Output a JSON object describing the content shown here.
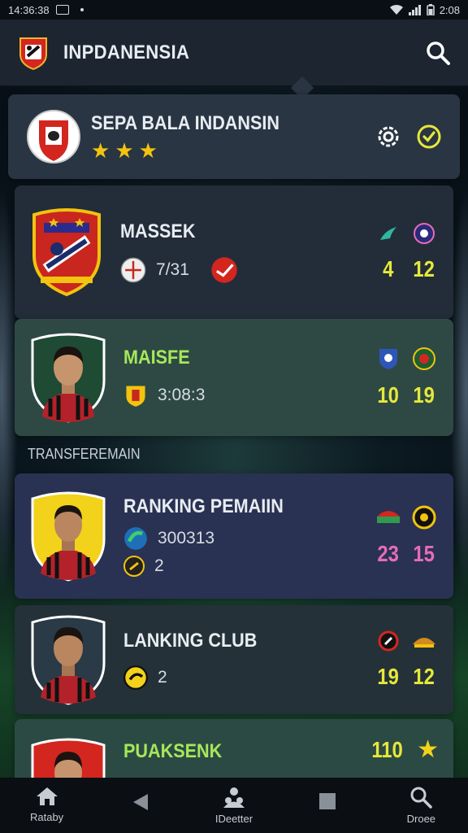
{
  "status_bar": {
    "time": "14:36:38",
    "right_time": "2:08"
  },
  "app_bar": {
    "title": "INPDANENSIA"
  },
  "league": {
    "name": "SEPA BALA INDANSIN",
    "stars": 3
  },
  "cards": [
    {
      "name": "MASSEK",
      "meta_text": "7/31",
      "stats": [
        "4",
        "12"
      ]
    },
    {
      "name": "MAISFE",
      "meta_text": "3:08:3",
      "stats": [
        "10",
        "19"
      ]
    },
    {
      "name": "RANKING PEMAIIN",
      "meta_text": "300313",
      "meta_text_2": "2",
      "stats": [
        "23",
        "15"
      ]
    },
    {
      "name": "LANKING CLUB",
      "meta_text": "2",
      "stats": [
        "19",
        "12"
      ]
    },
    {
      "name": "PUAKSENK",
      "stats": [
        "110"
      ]
    }
  ],
  "section_label": "TRANSFEREMAIN",
  "nav": [
    {
      "label": "Rataby",
      "icon": "home-icon"
    },
    {
      "label": "",
      "icon": "back-icon"
    },
    {
      "label": "IDeetter",
      "icon": "people-icon"
    },
    {
      "label": "",
      "icon": "square-icon"
    },
    {
      "label": "Droee",
      "icon": "search-icon"
    }
  ],
  "colors": {
    "accent_yellow": "#e6e83a",
    "accent_pink": "#e66bb8",
    "star": "#f2c30f"
  }
}
